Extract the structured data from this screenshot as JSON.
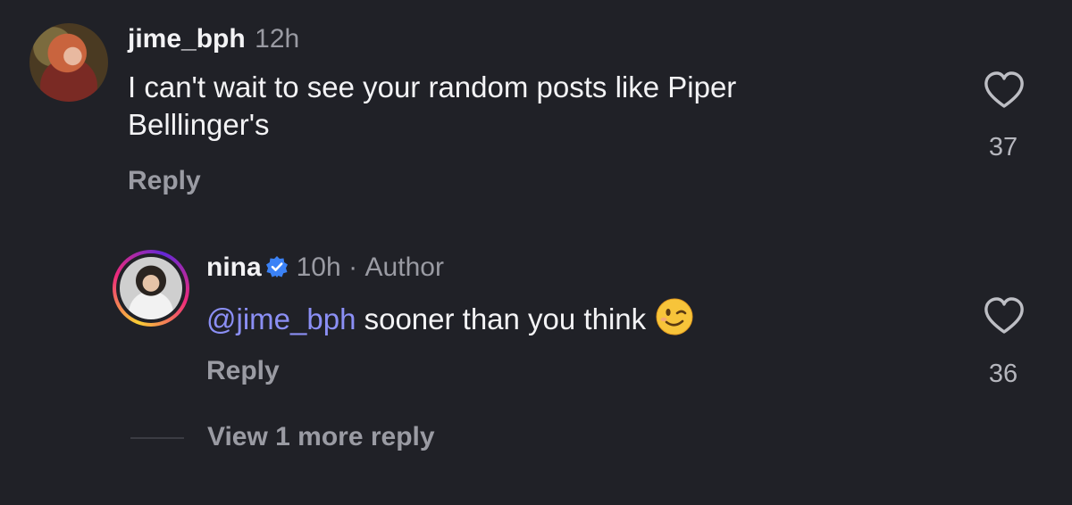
{
  "comment1": {
    "username": "jime_bph",
    "time": "12h",
    "text_line1": "I can't wait to see your random posts like Piper",
    "text_line2": "Belllinger's",
    "reply_label": "Reply",
    "likes": "37"
  },
  "comment2": {
    "username": "nina",
    "time": "10h",
    "separator": "·",
    "author_label": "Author",
    "mention": "@jime_bph",
    "text": " sooner than you think",
    "emoji": "winking-face",
    "reply_label": "Reply",
    "likes": "36"
  },
  "view_more_label": "View 1 more reply",
  "colors": {
    "background": "#202127",
    "mention": "#8b8ff5",
    "verified": "#3b82f6"
  }
}
